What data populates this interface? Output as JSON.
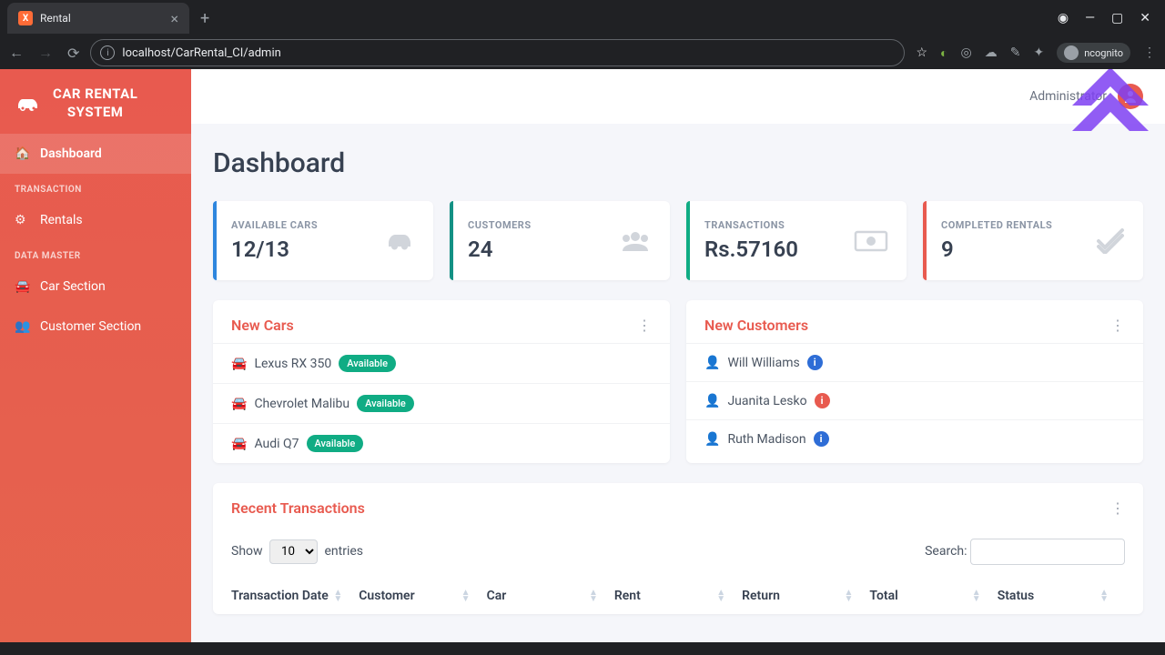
{
  "browser": {
    "tab_title": "Rental",
    "url": "localhost/CarRental_CI/admin",
    "incognito_label": "ncognito"
  },
  "sidebar": {
    "brand_line1": "CAR RENTAL",
    "brand_line2": "SYSTEM",
    "items": [
      {
        "label": "Dashboard",
        "icon": "home-icon"
      },
      {
        "label": "Rentals",
        "icon": "gear-icon"
      },
      {
        "label": "Car Section",
        "icon": "car-icon"
      },
      {
        "label": "Customer Section",
        "icon": "users-icon"
      }
    ],
    "section_transaction": "TRANSACTION",
    "section_datamaster": "DATA MASTER"
  },
  "topbar": {
    "user_name": "Administrator"
  },
  "page": {
    "title": "Dashboard"
  },
  "stats": {
    "available_cars": {
      "label": "AVAILABLE CARS",
      "value": "12/13"
    },
    "customers": {
      "label": "CUSTOMERS",
      "value": "24"
    },
    "transactions": {
      "label": "TRANSACTIONS",
      "value": "Rs.57160"
    },
    "completed": {
      "label": "COMPLETED RENTALS",
      "value": "9"
    }
  },
  "new_cars": {
    "title": "New Cars",
    "available_badge": "Available",
    "items": [
      {
        "name": "Lexus RX 350"
      },
      {
        "name": "Chevrolet Malibu"
      },
      {
        "name": "Audi Q7"
      }
    ]
  },
  "new_customers": {
    "title": "New Customers",
    "items": [
      {
        "name": "Will Williams",
        "dot": "blue"
      },
      {
        "name": "Juanita Lesko",
        "dot": "red"
      },
      {
        "name": "Ruth Madison",
        "dot": "blue"
      }
    ]
  },
  "recent_transactions": {
    "title": "Recent Transactions",
    "show_label": "Show",
    "entries_label": "entries",
    "page_size": "10",
    "search_label": "Search:",
    "columns": [
      "Transaction Date",
      "Customer",
      "Car",
      "Rent",
      "Return",
      "Total",
      "Status"
    ]
  }
}
